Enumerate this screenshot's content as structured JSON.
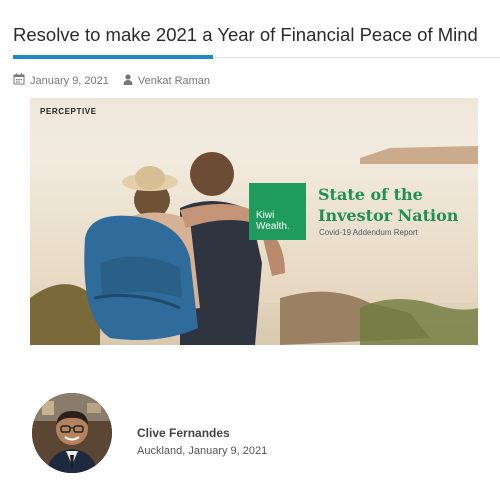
{
  "article": {
    "title": "Resolve to make 2021 a Year of Financial Peace of Mind",
    "date": "January 9, 2021",
    "author": "Venkat Raman"
  },
  "hero": {
    "brand": "PERCEPTIVE",
    "kiwi_line1": "Kiwi",
    "kiwi_line2": "Wealth.",
    "report_title_line1": "State of the",
    "report_title_line2": "Investor Nation",
    "report_subtitle": "Covid-19 Addendum Report"
  },
  "byline": {
    "name": "Clive Fernandes",
    "location_date": "Auckland, January 9, 2021"
  },
  "colors": {
    "accent_blue": "#1e8ac8",
    "kiwi_green": "#1f9c5d"
  }
}
